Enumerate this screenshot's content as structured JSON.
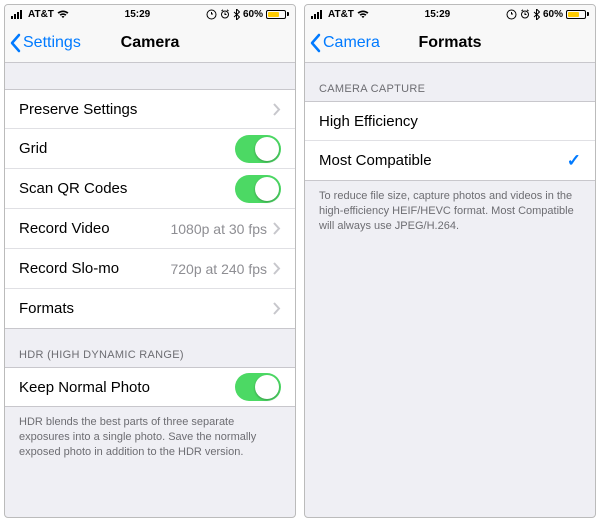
{
  "status": {
    "carrier": "AT&T",
    "time": "15:29",
    "battery": "60%",
    "wifi": true,
    "alarm": true,
    "bt": true,
    "rotlock": true
  },
  "left": {
    "back": "Settings",
    "title": "Camera",
    "rows": {
      "preserve": "Preserve Settings",
      "grid": "Grid",
      "qr": "Scan QR Codes",
      "record": "Record Video",
      "record_detail": "1080p at 30 fps",
      "slomo": "Record Slo-mo",
      "slomo_detail": "720p at 240 fps",
      "formats": "Formats"
    },
    "hdr_header": "HDR (HIGH DYNAMIC RANGE)",
    "keep_normal": "Keep Normal Photo",
    "hdr_note": "HDR blends the best parts of three separate exposures into a single photo. Save the normally exposed photo in addition to the HDR version."
  },
  "right": {
    "back": "Camera",
    "title": "Formats",
    "section": "CAMERA CAPTURE",
    "opt1": "High Efficiency",
    "opt2": "Most Compatible",
    "note": "To reduce file size, capture photos and videos in the high-efficiency HEIF/HEVC format. Most Compatible will always use JPEG/H.264."
  }
}
